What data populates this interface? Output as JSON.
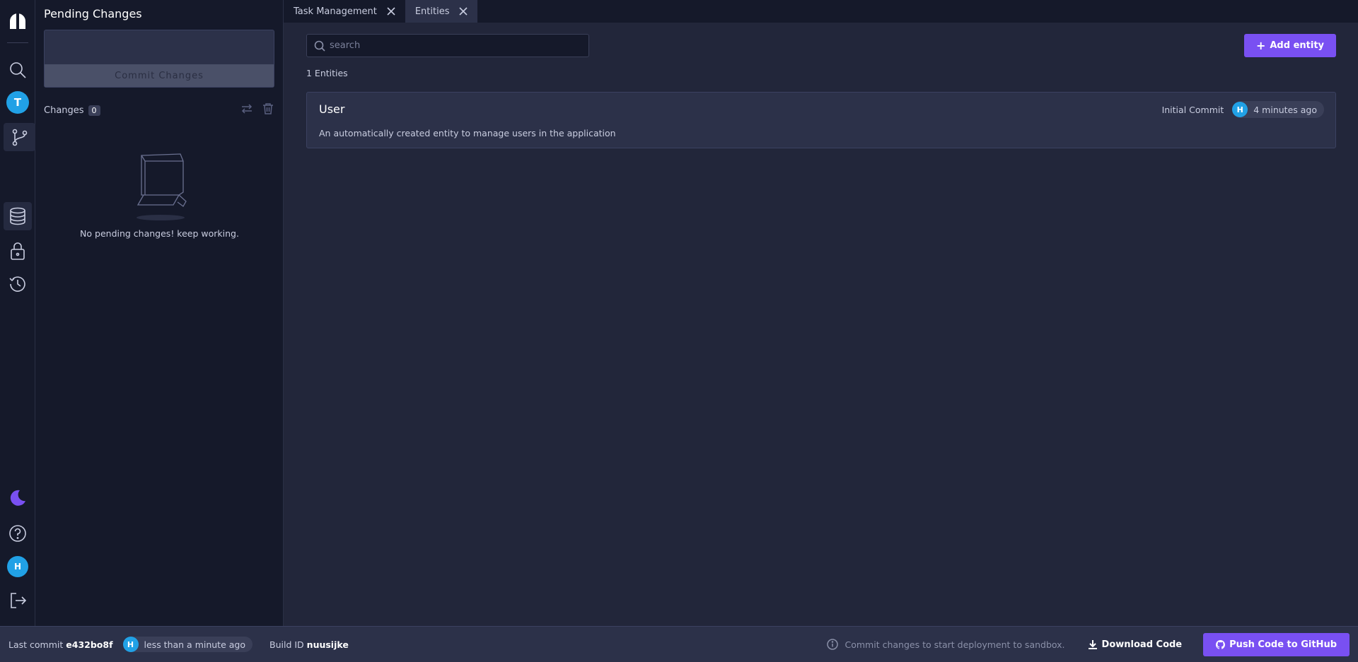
{
  "pending": {
    "title": "Pending Changes",
    "commit_button": "Commit Changes",
    "changes_label": "Changes",
    "changes_count": "0",
    "empty_text": "No pending changes! keep working."
  },
  "rail": {
    "workspace_initial": "T",
    "user_initial": "H",
    "icons": [
      "logo-icon",
      "search-icon",
      "git-branch-icon",
      "database-icon",
      "lock-icon",
      "history-icon",
      "moon-icon",
      "help-icon",
      "logout-icon"
    ]
  },
  "tabs": [
    {
      "label": "Task Management"
    },
    {
      "label": "Entities"
    }
  ],
  "main": {
    "search_placeholder": "search",
    "add_button": "Add entity",
    "count_label": "1 Entities",
    "entities": [
      {
        "name": "User",
        "description": "An automatically created entity to manage users in the application",
        "commit_message": "Initial Commit",
        "author_initial": "H",
        "time": "4 minutes ago"
      }
    ]
  },
  "footer": {
    "last_commit_label": "Last commit",
    "last_commit_id": "e432bo8f",
    "author_initial": "H",
    "commit_time": "less than a minute ago",
    "build_label": "Build ID",
    "build_id": "nuusijke",
    "info_text": "Commit changes to start deployment to sandbox.",
    "download_label": "Download Code",
    "push_label": "Push Code to GitHub"
  },
  "colors": {
    "accent": "#7950f2",
    "avatar": "#21a1e6",
    "sidebar_bg": "#15192a",
    "main_bg": "#22263a"
  }
}
